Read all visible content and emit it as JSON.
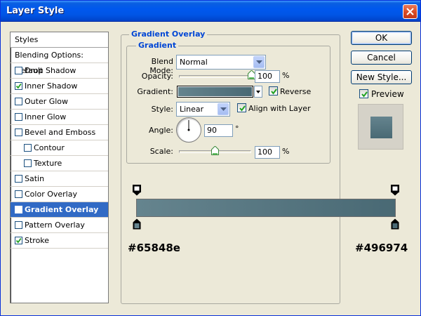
{
  "window": {
    "title": "Layer Style"
  },
  "styles": {
    "header": "Styles",
    "items": [
      {
        "label": "Blending Options: Default",
        "checkbox": false,
        "checked": false,
        "sub": false,
        "selected": false
      },
      {
        "label": "Drop Shadow",
        "checkbox": true,
        "checked": false,
        "sub": false,
        "selected": false
      },
      {
        "label": "Inner Shadow",
        "checkbox": true,
        "checked": true,
        "sub": false,
        "selected": false
      },
      {
        "label": "Outer Glow",
        "checkbox": true,
        "checked": false,
        "sub": false,
        "selected": false
      },
      {
        "label": "Inner Glow",
        "checkbox": true,
        "checked": false,
        "sub": false,
        "selected": false
      },
      {
        "label": "Bevel and Emboss",
        "checkbox": true,
        "checked": false,
        "sub": false,
        "selected": false
      },
      {
        "label": "Contour",
        "checkbox": true,
        "checked": false,
        "sub": true,
        "selected": false
      },
      {
        "label": "Texture",
        "checkbox": true,
        "checked": false,
        "sub": true,
        "selected": false
      },
      {
        "label": "Satin",
        "checkbox": true,
        "checked": false,
        "sub": false,
        "selected": false
      },
      {
        "label": "Color Overlay",
        "checkbox": true,
        "checked": false,
        "sub": false,
        "selected": false
      },
      {
        "label": "Gradient Overlay",
        "checkbox": true,
        "checked": true,
        "sub": false,
        "selected": true
      },
      {
        "label": "Pattern Overlay",
        "checkbox": true,
        "checked": false,
        "sub": false,
        "selected": false
      },
      {
        "label": "Stroke",
        "checkbox": true,
        "checked": true,
        "sub": false,
        "selected": false
      }
    ]
  },
  "gradient_overlay": {
    "group_title": "Gradient Overlay",
    "sub_title": "Gradient",
    "blend_mode": {
      "label": "Blend Mode:",
      "value": "Normal"
    },
    "opacity": {
      "label": "Opacity:",
      "value": "100",
      "unit": "%",
      "level": 1.0
    },
    "gradient": {
      "label": "Gradient:",
      "reverse_label": "Reverse",
      "reverse_checked": true
    },
    "style": {
      "label": "Style:",
      "value": "Linear",
      "align_label": "Align with Layer",
      "align_checked": true
    },
    "angle": {
      "label": "Angle:",
      "value": "90",
      "unit": "°"
    },
    "scale": {
      "label": "Scale:",
      "value": "100",
      "unit": "%",
      "level": 0.5
    }
  },
  "gradient_editor": {
    "start_color": "#65848e",
    "end_color": "#496974",
    "start_label": "#65848e",
    "end_label": "#496974"
  },
  "buttons": {
    "ok": "OK",
    "cancel": "Cancel",
    "new_style": "New Style...",
    "preview_label": "Preview",
    "preview_checked": true
  },
  "colors": {
    "title_bar": "#0055e5",
    "selection": "#316ac5",
    "group_title": "#0046d5",
    "preview_fill": "#5a7a85"
  }
}
